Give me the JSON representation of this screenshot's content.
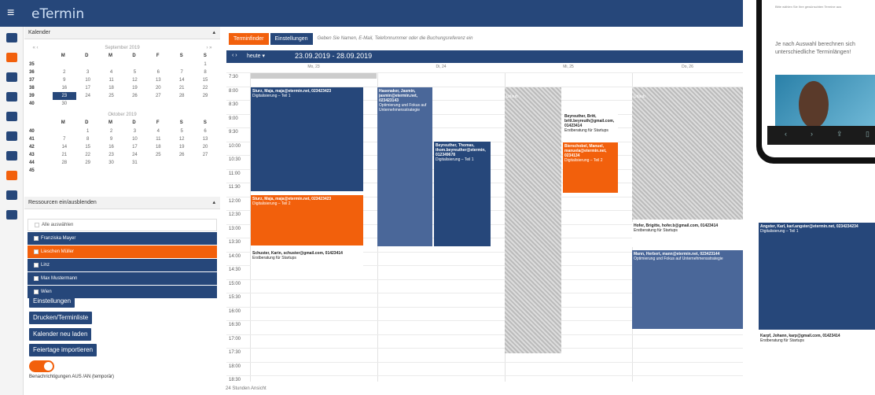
{
  "app": {
    "logo": "eTermin",
    "menu_icon": "hamburger-icon"
  },
  "calendar_panel": {
    "title": "Kalender"
  },
  "mini_sep": {
    "month": "September 2019",
    "dow": [
      "M",
      "D",
      "M",
      "D",
      "F",
      "S",
      "S"
    ],
    "weeks": [
      [
        "35",
        "",
        "",
        "",
        "",
        "",
        "",
        "1"
      ],
      [
        "36",
        "2",
        "3",
        "4",
        "5",
        "6",
        "7",
        "8"
      ],
      [
        "37",
        "9",
        "10",
        "11",
        "12",
        "13",
        "14",
        "15"
      ],
      [
        "38",
        "16",
        "17",
        "18",
        "19",
        "20",
        "21",
        "22"
      ],
      [
        "39",
        "23",
        "24",
        "25",
        "26",
        "27",
        "28",
        "29"
      ],
      [
        "40",
        "30",
        "",
        "",
        "",
        "",
        "",
        ""
      ]
    ]
  },
  "mini_oct": {
    "month": "Oktober 2019",
    "dow": [
      "M",
      "D",
      "M",
      "D",
      "F",
      "S",
      "S"
    ],
    "weeks": [
      [
        "40",
        "",
        "1",
        "2",
        "3",
        "4",
        "5",
        "6"
      ],
      [
        "41",
        "7",
        "8",
        "9",
        "10",
        "11",
        "12",
        "13"
      ],
      [
        "42",
        "14",
        "15",
        "16",
        "17",
        "18",
        "19",
        "20"
      ],
      [
        "43",
        "21",
        "22",
        "23",
        "24",
        "25",
        "26",
        "27"
      ],
      [
        "44",
        "28",
        "29",
        "30",
        "31",
        "",
        "",
        ""
      ],
      [
        "45",
        "",
        "",
        "",
        "",
        "",
        "",
        ""
      ]
    ]
  },
  "resources": {
    "title": "Ressourcen ein/ausblenden",
    "select_all": "Alle auswählen",
    "items": [
      {
        "label": "Franziska Mayer",
        "color": "#26477a"
      },
      {
        "label": "Lieschen Müller",
        "color": "#f2600c"
      },
      {
        "label": "Linz",
        "color": "#26477a"
      },
      {
        "label": "Max Mustermann",
        "color": "#26477a"
      },
      {
        "label": "Wien",
        "color": "#26477a"
      }
    ]
  },
  "buttons": {
    "settings": "Einstellungen",
    "print": "Drucken/Terminliste",
    "reload": "Kalender neu laden",
    "holidays": "Feiertage importieren"
  },
  "notifications": {
    "label": "Benachrichtigungen AUS /AN (temporär)"
  },
  "toolbar": {
    "finder": "Terminfinder",
    "settings": "Einstellungen",
    "hint": "Geben Sie Namen, E-Mail, Telefonnummer oder die Buchungsreferenz ein"
  },
  "nav": {
    "arrows": "‹ ›",
    "today": "heute ▾",
    "range": "23.09.2019 - 28.09.2019"
  },
  "days": [
    "Mo, 23",
    "Di, 24",
    "Mi, 25",
    "Do, 26"
  ],
  "times": [
    "7:30",
    "8:00",
    "8:30",
    "9:00",
    "9:30",
    "10:00",
    "10:30",
    "11:00",
    "11:30",
    "12:00",
    "12:30",
    "13:00",
    "13:30",
    "14:00",
    "14:30",
    "15:00",
    "15:30",
    "16:00",
    "16:30",
    "17:00",
    "17:30",
    "18:00",
    "18:30"
  ],
  "events": {
    "e1_title": "Sturz, Maja, maja@etermin.net, 023423423",
    "e1_sub": "Digitalisierung – Teil 1",
    "e2_title": "Sturz, Maja, maja@etermin.net, 023423423",
    "e2_sub": "Digitalisierung – Teil 2",
    "e3_title": "Schuster, Karin, schuster@gmail.com, 01423414",
    "e3_sub": "Erstberatung für Startups",
    "e4_title": "Hasenaker, Jasmin, jasmin@etermin.net, 023423143",
    "e4_sub": "Optimierung und Fokus auf Unternehmensstrategie",
    "e5_title": "Beyreuther, Thomas, thom.beyreuther@etermin, 012349678",
    "e5_sub": "Digitalisierung – Teil 1",
    "e6_label": "Urlaub",
    "e7_title": "Beyreuther, Britt, britt.beyreuth@gmail.com, 01423414",
    "e7_sub": "Erstberatung für Startups",
    "e8_title": "Bierschobel, Manuel, manuela@etermin.net, 0234134",
    "e8_sub": "Digitalisierung – Teil 2",
    "e9_label": "Urlaub",
    "e10_title": "Hofer, Brigitte, hofer.b@gmail.com, 01423414",
    "e10_sub": "Erstberatung für Startups",
    "e11_title": "Mann, Herbert, mann@etermin.net, 023423144",
    "e11_sub": "Optimierung und Fokus auf Unternehmensstrategie",
    "e12_title": "Angster, Karl, karl.angster@etermin.net, 0234234234",
    "e12_sub": "Digitalisierung – Teil 1",
    "e13_title": "Karpf, Johann, karp@gmail.com, 01423414",
    "e13_sub": "Erstberatung für Startups"
  },
  "footer": "24 Stunden Ansicht",
  "phone": {
    "top": "Bitte wählen Sie Ihre gewünschten Termine aus",
    "text": "Je nach Auswahl berechnen sich unterschiedliche Termin­längen!"
  }
}
